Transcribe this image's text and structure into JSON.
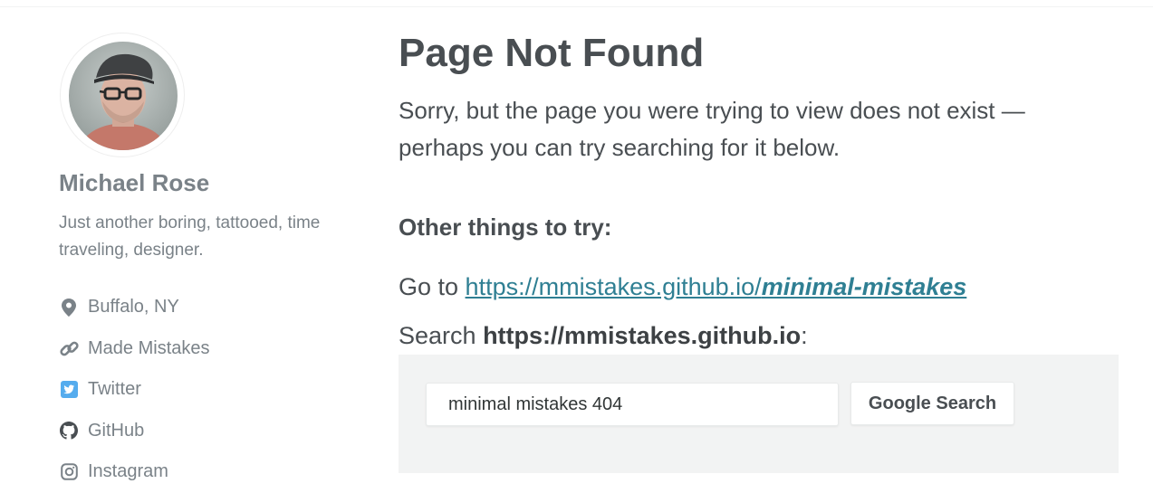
{
  "sidebar": {
    "author": {
      "name": "Michael Rose",
      "bio": "Just another boring, tattooed, time traveling, designer."
    },
    "links": [
      {
        "label": "Buffalo, NY",
        "icon": "map-marker-icon",
        "color": "#7a8288"
      },
      {
        "label": "Made Mistakes",
        "icon": "link-icon",
        "color": "#7a8288"
      },
      {
        "label": "Twitter",
        "icon": "twitter-icon",
        "color": "#55acee"
      },
      {
        "label": "GitHub",
        "icon": "github-icon",
        "color": "#494e52"
      },
      {
        "label": "Instagram",
        "icon": "instagram-icon",
        "color": "#7a8288"
      }
    ]
  },
  "main": {
    "title": "Page Not Found",
    "lead": "Sorry, but the page you were trying to view does not exist — perhaps you can try searching for it below.",
    "sub_heading": "Other things to try:",
    "goto": {
      "prefix": "Go to ",
      "link_base": "https://mmistakes.github.io/",
      "link_bold": "minimal-mistakes"
    },
    "search": {
      "prefix": "Search ",
      "site": "https://mmistakes.github.io",
      "suffix": ":",
      "input_value": "minimal mistakes 404",
      "button_label": "Google Search"
    }
  },
  "colors": {
    "text": "#494e52",
    "muted": "#7a8288",
    "link": "#2f7f93",
    "search_bg": "#f2f3f3"
  }
}
